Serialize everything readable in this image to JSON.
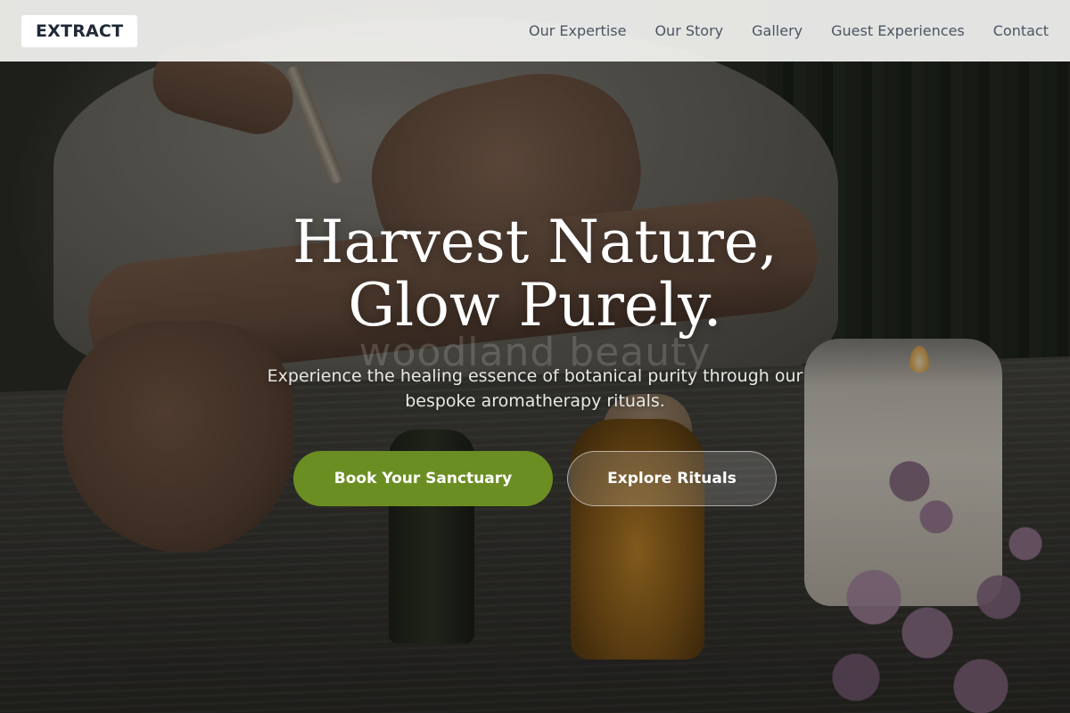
{
  "brand": {
    "logo_text": "EXTRACT"
  },
  "nav": {
    "items": [
      {
        "label": "Our Expertise"
      },
      {
        "label": "Our Story"
      },
      {
        "label": "Gallery"
      },
      {
        "label": "Guest Experiences"
      },
      {
        "label": "Contact"
      }
    ]
  },
  "hero": {
    "headline_line1": "Harvest Nature,",
    "headline_line2": "Glow Purely.",
    "watermark": "woodland beauty",
    "subtitle": "Experience the healing essence of botanical purity through our bespoke aromatherapy rituals.",
    "primary_cta": "Book Your Sanctuary",
    "secondary_cta": "Explore Rituals"
  },
  "colors": {
    "accent_green": "#6b8e23",
    "nav_background": "#f3f3f1",
    "nav_text": "#4b5563",
    "logo_text": "#1f2937"
  }
}
